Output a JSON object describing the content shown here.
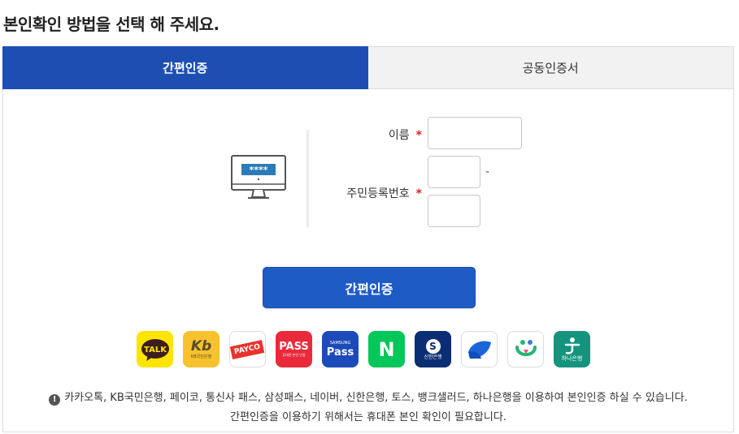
{
  "page": {
    "title": "본인확인 방법을 선택 해 주세요."
  },
  "tabs": [
    {
      "label": "간편인증",
      "active": true
    },
    {
      "label": "공동인증서",
      "active": false
    }
  ],
  "form": {
    "name_label": "이름",
    "rrn_label": "주민등록번호",
    "required_mark": "*",
    "rrn_separator": "-",
    "name_value": "",
    "rrn_front_value": "",
    "rrn_back_value": ""
  },
  "monitor": {
    "masked_text": "****"
  },
  "submit_label": "간편인증",
  "providers": [
    {
      "id": "kakaotalk",
      "text": "TALK",
      "bg": "#fee500",
      "fg": "#3c1e1e"
    },
    {
      "id": "kb",
      "text": "Kb",
      "sub": "KB국민은행",
      "bg": "#f7c22e",
      "fg": "#5a4a2a"
    },
    {
      "id": "payco",
      "text": "PAYCO",
      "bg": "#ffffff",
      "fg": "#e8322e"
    },
    {
      "id": "pass",
      "text": "PASS",
      "sub": "휴대폰 본인 인증",
      "bg": "#ea2a3b",
      "fg": "#ffffff"
    },
    {
      "id": "samsung-pass",
      "text": "Pass",
      "sub": "SAMSUNG",
      "bg": "#1c4ab8",
      "fg": "#ffffff"
    },
    {
      "id": "naver",
      "text": "N",
      "bg": "#03c75a",
      "fg": "#ffffff"
    },
    {
      "id": "shinhan",
      "text": "S",
      "sub": "신한은행",
      "bg": "#0b2d73",
      "fg": "#ffffff"
    },
    {
      "id": "toss",
      "text": "",
      "bg": "#ffffff",
      "fg": "#1b64da"
    },
    {
      "id": "banksalad",
      "text": "",
      "bg": "#ffffff",
      "fg": "#22b573"
    },
    {
      "id": "hana",
      "text": "하나은행",
      "bg": "#14937d",
      "fg": "#ffffff"
    }
  ],
  "notice": {
    "line1": "카카오톡, KB국민은행, 페이코, 통신사 패스, 삼성패스, 네이버, 신한은행, 토스, 뱅크샐러드, 하나은행을 이용하여 본인인증 하실 수 있습니다.",
    "line2": "간편인증을 이용하기 위해서는 휴대폰 본인 확인이 필요합니다."
  },
  "colors": {
    "primary": "#1d4fb3",
    "button": "#1f5bc5",
    "required": "#e02020"
  }
}
